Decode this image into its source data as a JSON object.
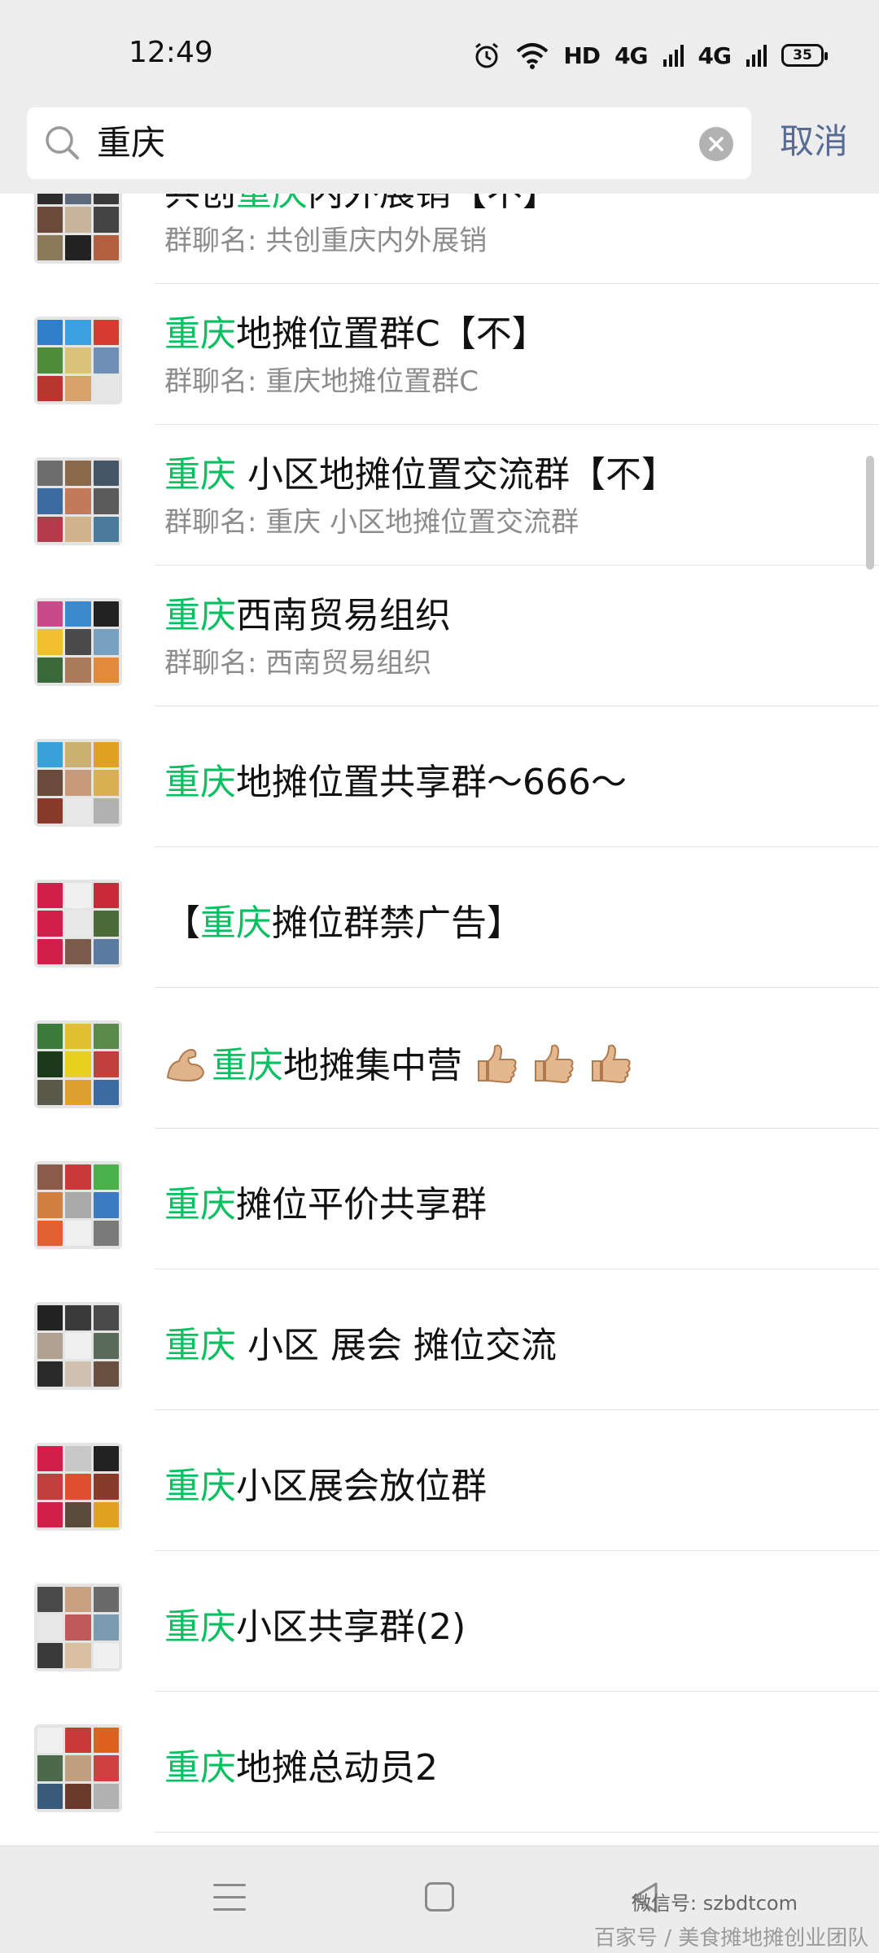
{
  "status_bar": {
    "time": "12:49",
    "network_label": "HD",
    "signal_1": "4G",
    "signal_2": "4G",
    "battery": "35"
  },
  "search": {
    "query": "重庆",
    "cancel_label": "取消"
  },
  "results": [
    {
      "pre": "共创",
      "hl": "重庆",
      "post": "内外展销【不】",
      "sub": "群聊名: 共创重庆内外展销",
      "tiles": [
        "#2c2c2c",
        "#5e6a7a",
        "#3a3a3a",
        "#6b4a3a",
        "#c7b49a",
        "#444",
        "#8a7a5a",
        "#222",
        "#b06040"
      ]
    },
    {
      "pre": "",
      "hl": "重庆",
      "post": "地摊位置群C【不】",
      "sub": "群聊名: 重庆地摊位置群C",
      "tiles": [
        "#2f7ec9",
        "#3aa0e0",
        "#d63b2f",
        "#4f8c3a",
        "#d9c27a",
        "#6e8fb3",
        "#b5372e",
        "#d8a36a",
        "#e6e6e6"
      ]
    },
    {
      "pre": "",
      "hl": "重庆",
      "post": " 小区地摊位置交流群【不】",
      "sub": "群聊名: 重庆 小区地摊位置交流群",
      "tiles": [
        "#6d6d6d",
        "#8a6a4a",
        "#445566",
        "#3a6aa0",
        "#c27a5a",
        "#5a5a5a",
        "#b53a4a",
        "#d2b48c",
        "#4a7a9a"
      ]
    },
    {
      "pre": "",
      "hl": "重庆",
      "post": "西南贸易组织",
      "sub": "群聊名: 西南贸易组织",
      "tiles": [
        "#c84a8a",
        "#3a8ad0",
        "#222",
        "#f0c030",
        "#4a4a4a",
        "#7aa0c0",
        "#3a6a3a",
        "#aa7a5a",
        "#e08a3a"
      ]
    },
    {
      "pre": "",
      "hl": "重庆",
      "post": "地摊位置共享群～666～",
      "sub": "",
      "tiles": [
        "#3aa0d8",
        "#c8b070",
        "#e0a020",
        "#6a4a3a",
        "#c89a7a",
        "#d8b050",
        "#8a3a2a",
        "#e8e8e8",
        "#b0b0b0"
      ]
    },
    {
      "pre": "【",
      "hl": "重庆",
      "post": "摊位群禁广告】",
      "sub": "",
      "tiles": [
        "#d01f4a",
        "#f0f0f0",
        "#c82a3a",
        "#d01f4a",
        "#e8e8e8",
        "#4a6a3a",
        "#d01f4a",
        "#7a5a4a",
        "#5a7aa0"
      ]
    },
    {
      "pre": "",
      "hl": "重庆",
      "post": "地摊集中营",
      "sub": "",
      "emoji": true,
      "tiles": [
        "#3a7a3a",
        "#e0c030",
        "#5a8a4a",
        "#1a3a1a",
        "#e8d020",
        "#c04040",
        "#5a5a4a",
        "#e0a030",
        "#3a6aa0"
      ]
    },
    {
      "pre": "",
      "hl": "重庆",
      "post": "摊位平价共享群",
      "sub": "",
      "tiles": [
        "#8a5a4a",
        "#c83a3a",
        "#4ab04a",
        "#d08040",
        "#aaaaaa",
        "#3a7ac0",
        "#e06030",
        "#f0f0f0",
        "#7a7a7a"
      ]
    },
    {
      "pre": "",
      "hl": "重庆",
      "post": " 小区 展会 摊位交流",
      "sub": "",
      "tiles": [
        "#222",
        "#3a3a3a",
        "#4a4a4a",
        "#b0a090",
        "#f0f0f0",
        "#5a6a5a",
        "#2a2a2a",
        "#d0c0b0",
        "#6a5040"
      ]
    },
    {
      "pre": "",
      "hl": "重庆",
      "post": "小区展会放位群",
      "sub": "",
      "tiles": [
        "#d01f4a",
        "#c8c8c8",
        "#222",
        "#c04040",
        "#e05030",
        "#8a3a2a",
        "#d01f4a",
        "#5a4a3a",
        "#e0a020"
      ]
    },
    {
      "pre": "",
      "hl": "重庆",
      "post": "小区共享群(2)",
      "sub": "",
      "tiles": [
        "#4a4a4a",
        "#c8a080",
        "#6a6a6a",
        "#e8e8e8",
        "#c05a5a",
        "#7a9ab0",
        "#3a3a3a",
        "#d8c0a0",
        "#f0f0f0"
      ]
    },
    {
      "pre": "",
      "hl": "重庆",
      "post": "地摊总动员2",
      "sub": "",
      "tiles": [
        "#f0f0f0",
        "#c83a3a",
        "#e06020",
        "#4a6a4a",
        "#c0a080",
        "#d04040",
        "#3a5a7a",
        "#6a3a2a",
        "#b0b0b0"
      ]
    }
  ],
  "watermark": {
    "line1": "微信号: szbdtcom",
    "line2": "百家号 / 美食摊地摊创业团队"
  }
}
